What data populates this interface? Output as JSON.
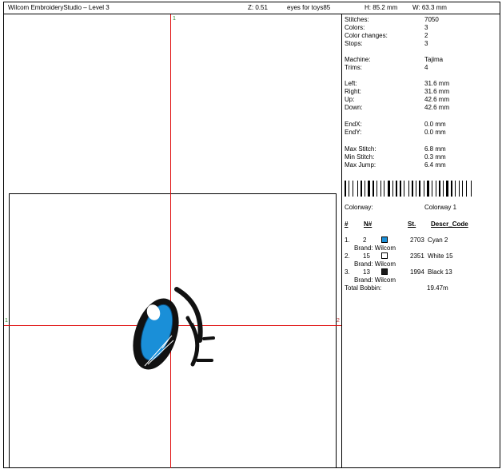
{
  "header": {
    "title": "Wilcom EmbroideryStudio – Level 3",
    "zoom": "Z: 0.51",
    "design_name": "eyes for toys85",
    "height": "H: 85.2 mm",
    "width": "W: 63.3 mm"
  },
  "canvas": {
    "axis_top_label": "1",
    "axis_left_label": "1",
    "axis_right_label": "2"
  },
  "stats": [
    {
      "label": "Stitches:",
      "value": "7050"
    },
    {
      "label": "Colors:",
      "value": "3"
    },
    {
      "label": "Color changes:",
      "value": "2"
    },
    {
      "label": "Stops:",
      "value": "3"
    },
    {
      "label": "Machine:",
      "value": "Tajima"
    },
    {
      "label": "Trims:",
      "value": "4"
    },
    {
      "label": "Left:",
      "value": "31.6 mm"
    },
    {
      "label": "Right:",
      "value": "31.6 mm"
    },
    {
      "label": "Up:",
      "value": "42.6 mm"
    },
    {
      "label": "Down:",
      "value": "42.6 mm"
    },
    {
      "label": "EndX:",
      "value": "0.0 mm"
    },
    {
      "label": "EndY:",
      "value": "0.0 mm"
    },
    {
      "label": "Max Stitch:",
      "value": "6.8 mm"
    },
    {
      "label": "Min Stitch:",
      "value": "0.3 mm"
    },
    {
      "label": "Max Jump:",
      "value": "6.4 mm"
    }
  ],
  "colorway": {
    "label": "Colorway:",
    "value": "Colorway 1"
  },
  "table_headers": {
    "index": "#",
    "n": "N#",
    "st": "St.",
    "descr": "Descr_Code"
  },
  "colors": [
    {
      "index": "1.",
      "n": "2",
      "stitches": "2703",
      "descr": "Cyan 2",
      "brand": "Brand: Wilcom",
      "swatch": "#1a8fd8"
    },
    {
      "index": "2.",
      "n": "15",
      "stitches": "2351",
      "descr": "White 15",
      "brand": "Brand: Wilcom",
      "swatch": "#ffffff"
    },
    {
      "index": "3.",
      "n": "13",
      "stitches": "1994",
      "descr": "Black 13",
      "brand": "Brand: Wilcom",
      "swatch": "#1a1a1a"
    }
  ],
  "total_bobbin": {
    "label": "Total Bobbin:",
    "value": "19.47m"
  },
  "palette": {
    "axis": "#e01010",
    "cyan": "#1a8fd8",
    "black": "#111111",
    "white": "#ffffff"
  }
}
